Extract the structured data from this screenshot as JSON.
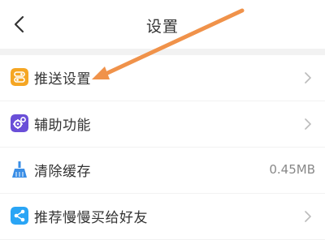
{
  "header": {
    "title": "设置"
  },
  "items": [
    {
      "label": "推送设置",
      "icon": "toggle-settings-icon",
      "icon_color": "#F5A623",
      "has_chevron": true
    },
    {
      "label": "辅助功能",
      "icon": "gears-icon",
      "icon_color": "#6A4FD8",
      "has_chevron": true
    },
    {
      "label": "清除缓存",
      "icon": "broom-icon",
      "icon_color": "#3A8EE6",
      "value": "0.45MB"
    },
    {
      "label": "推荐慢慢买给好友",
      "icon": "share-icon",
      "icon_color": "#2AA5F5",
      "has_chevron": true
    }
  ],
  "annotation": {
    "arrow_color": "#F0924A"
  }
}
